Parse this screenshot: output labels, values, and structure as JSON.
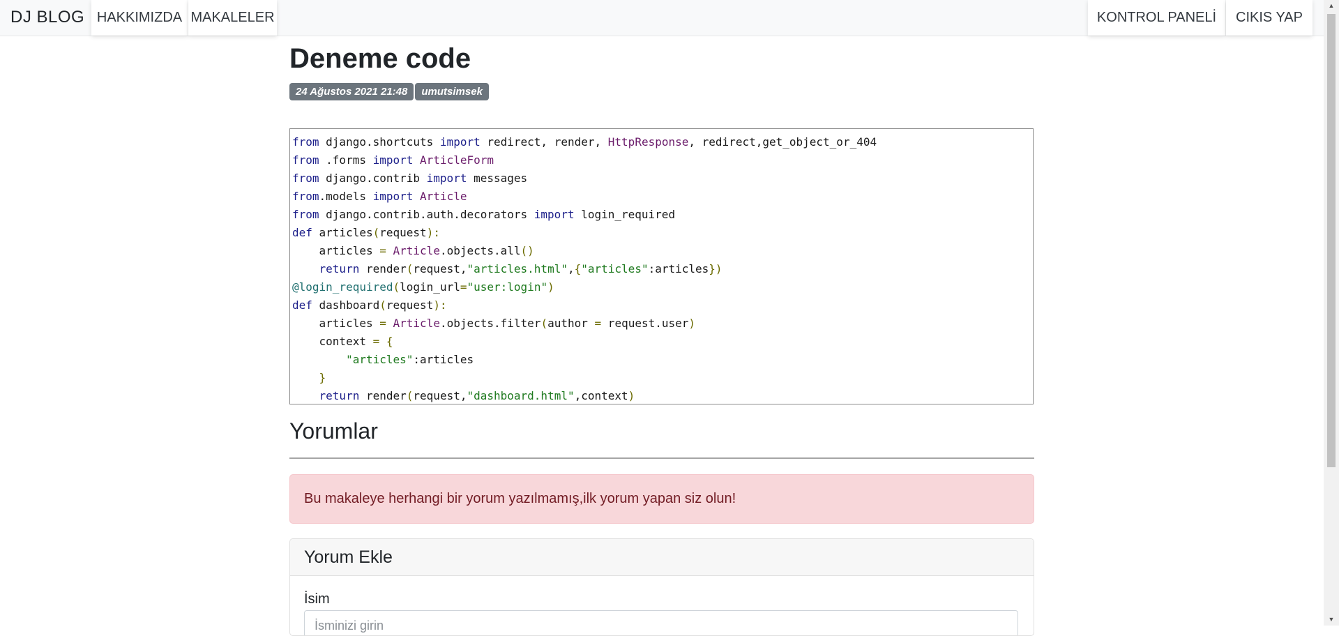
{
  "navbar": {
    "brand": "DJ BLOG",
    "left_links": [
      "HAKKIMIZDA",
      "MAKALELER"
    ],
    "right_links": [
      "KONTROL PANELİ",
      "CIKIS YAP"
    ]
  },
  "article": {
    "title": "Deneme code",
    "date": "24 Ağustos 2021 21:48",
    "author": "umutsimsek"
  },
  "code_lines": [
    [
      [
        "from",
        "kw"
      ],
      [
        " django.shortcuts ",
        ""
      ],
      [
        "import",
        "kw"
      ],
      [
        " redirect",
        ""
      ],
      [
        ",",
        ""
      ],
      [
        " render",
        ""
      ],
      [
        ",",
        ""
      ],
      [
        " ",
        ""
      ],
      [
        "HttpResponse",
        "cls"
      ],
      [
        ",",
        ""
      ],
      [
        " redirect,get_object_or_404",
        ""
      ]
    ],
    [
      [
        "from",
        "kw"
      ],
      [
        " .forms ",
        ""
      ],
      [
        "import",
        "kw"
      ],
      [
        " ",
        ""
      ],
      [
        "ArticleForm",
        "cls"
      ]
    ],
    [
      [
        "from",
        "kw"
      ],
      [
        " django.contrib ",
        ""
      ],
      [
        "import",
        "kw"
      ],
      [
        " messages",
        ""
      ]
    ],
    [
      [
        "from",
        "kw"
      ],
      [
        ".models ",
        ""
      ],
      [
        "import",
        "kw"
      ],
      [
        " ",
        ""
      ],
      [
        "Article",
        "cls"
      ]
    ],
    [
      [
        "from",
        "kw"
      ],
      [
        " django.contrib.auth.decorators ",
        ""
      ],
      [
        "import",
        "kw"
      ],
      [
        " login_required",
        ""
      ]
    ],
    [
      [
        "def",
        "kw"
      ],
      [
        " articles",
        ""
      ],
      [
        "(",
        "op"
      ],
      [
        "request",
        ""
      ],
      [
        "):",
        "op"
      ]
    ],
    [
      [
        "    articles ",
        ""
      ],
      [
        "=",
        "op"
      ],
      [
        " ",
        ""
      ],
      [
        "Article",
        "cls"
      ],
      [
        ".objects.all",
        ""
      ],
      [
        "()",
        "op"
      ]
    ],
    [
      [
        "    ",
        ""
      ],
      [
        "return",
        "kw"
      ],
      [
        " render",
        ""
      ],
      [
        "(",
        "op"
      ],
      [
        "request,",
        ""
      ],
      [
        "\"articles.html\"",
        "str"
      ],
      [
        ",",
        ""
      ],
      [
        "{",
        "op"
      ],
      [
        "\"articles\"",
        "str"
      ],
      [
        ":articles",
        ""
      ],
      [
        "})",
        "op"
      ]
    ],
    [
      [
        "@login_required",
        "deco"
      ],
      [
        "(",
        "op"
      ],
      [
        "login_url",
        ""
      ],
      [
        "=",
        "op"
      ],
      [
        "\"user:login\"",
        "str"
      ],
      [
        ")",
        "op"
      ]
    ],
    [
      [
        "def",
        "kw"
      ],
      [
        " dashboard",
        ""
      ],
      [
        "(",
        "op"
      ],
      [
        "request",
        ""
      ],
      [
        "):",
        "op"
      ]
    ],
    [
      [
        "    articles ",
        ""
      ],
      [
        "=",
        "op"
      ],
      [
        " ",
        ""
      ],
      [
        "Article",
        "cls"
      ],
      [
        ".objects.filter",
        ""
      ],
      [
        "(",
        "op"
      ],
      [
        "author ",
        ""
      ],
      [
        "=",
        "op"
      ],
      [
        " request.user",
        ""
      ],
      [
        ")",
        "op"
      ]
    ],
    [
      [
        "    context ",
        ""
      ],
      [
        "=",
        "op"
      ],
      [
        " ",
        ""
      ],
      [
        "{",
        "op"
      ]
    ],
    [
      [
        "        ",
        ""
      ],
      [
        "\"articles\"",
        "str"
      ],
      [
        ":articles",
        ""
      ]
    ],
    [
      [
        "    ",
        ""
      ],
      [
        "}",
        "op"
      ]
    ],
    [
      [
        "    ",
        ""
      ],
      [
        "return",
        "kw"
      ],
      [
        " render",
        ""
      ],
      [
        "(",
        "op"
      ],
      [
        "request,",
        ""
      ],
      [
        "\"dashboard.html\"",
        "str"
      ],
      [
        ",context",
        ""
      ],
      [
        ")",
        "op"
      ]
    ]
  ],
  "comments": {
    "title": "Yorumlar",
    "empty_message": "Bu makaleye herhangi bir yorum yazılmamış,ilk yorum yapan siz olun!"
  },
  "comment_form": {
    "title": "Yorum Ekle",
    "name_label": "İsim",
    "name_placeholder": "İsminizi girin"
  },
  "icons": {
    "scroll_up": "chevron-up-icon",
    "scroll_down": "chevron-down-icon"
  }
}
